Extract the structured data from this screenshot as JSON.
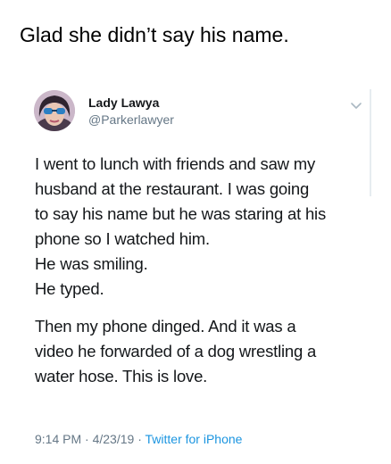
{
  "caption": "Glad she didn’t say his name.",
  "tweet": {
    "user": {
      "display_name": "Lady Lawya",
      "handle": "@Parkerlawyer"
    },
    "menu_icon": "chevron-down-icon",
    "paragraphs": [
      {
        "lines": [
          "I went to lunch with friends and saw my",
          "husband at the restaurant. I was going",
          "to say his name but he was staring at his",
          "phone so I watched him.",
          "He was smiling.",
          "He typed."
        ]
      },
      {
        "lines": [
          "Then my phone dinged. And it was a",
          "video he forwarded of a dog wrestling a",
          "water hose. This is love."
        ]
      }
    ],
    "time": "9:14 PM",
    "date": "4/23/19",
    "separator": "·",
    "source": "Twitter for iPhone"
  },
  "colors": {
    "text": "#14171a",
    "secondary": "#657786",
    "link": "#1b95e0"
  }
}
